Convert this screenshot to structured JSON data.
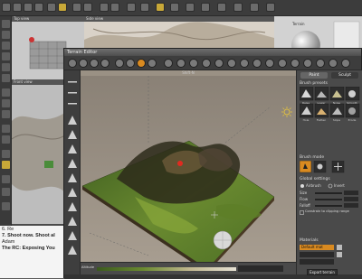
{
  "viewports": {
    "top_view_label": "Top view",
    "side_view_label": "Side view",
    "front_view_label": "Front view"
  },
  "right_panel": {
    "label": "Terrain"
  },
  "notes": {
    "line1": "6. Re",
    "line2": "7. Shoot now. Shoot al",
    "line3": "Adam",
    "line4": "The RC: Exposing You"
  },
  "terrain_editor": {
    "title": "Terrain Editor",
    "coord_label": "Shift-N",
    "tabs": {
      "paint": "Paint",
      "sculpt": "Sculpt"
    },
    "brush_presets_label": "Brush presets",
    "brush_names": [
      "Raise",
      "Lower",
      "Noise",
      "Smooth",
      "Hole",
      "Flatten",
      "Slope",
      "Erode"
    ],
    "brush_mode_label": "Brush mode",
    "global_settings_label": "Global settings",
    "radios": {
      "airbrush": "Airbrush",
      "invert": "Invert"
    },
    "sliders": {
      "size": "Size",
      "flow": "Flow",
      "falloff": "Falloff"
    },
    "constrain_label": "Constrain to clipping range",
    "materials_label": "Materials",
    "material_default": "Default mat",
    "altitude_label": "Altitude",
    "export_button": "Export terrain"
  },
  "colors": {
    "terrain_green": "#4f7a2a",
    "terrain_dark": "#2c2a18",
    "orange_select": "#d98a20"
  }
}
